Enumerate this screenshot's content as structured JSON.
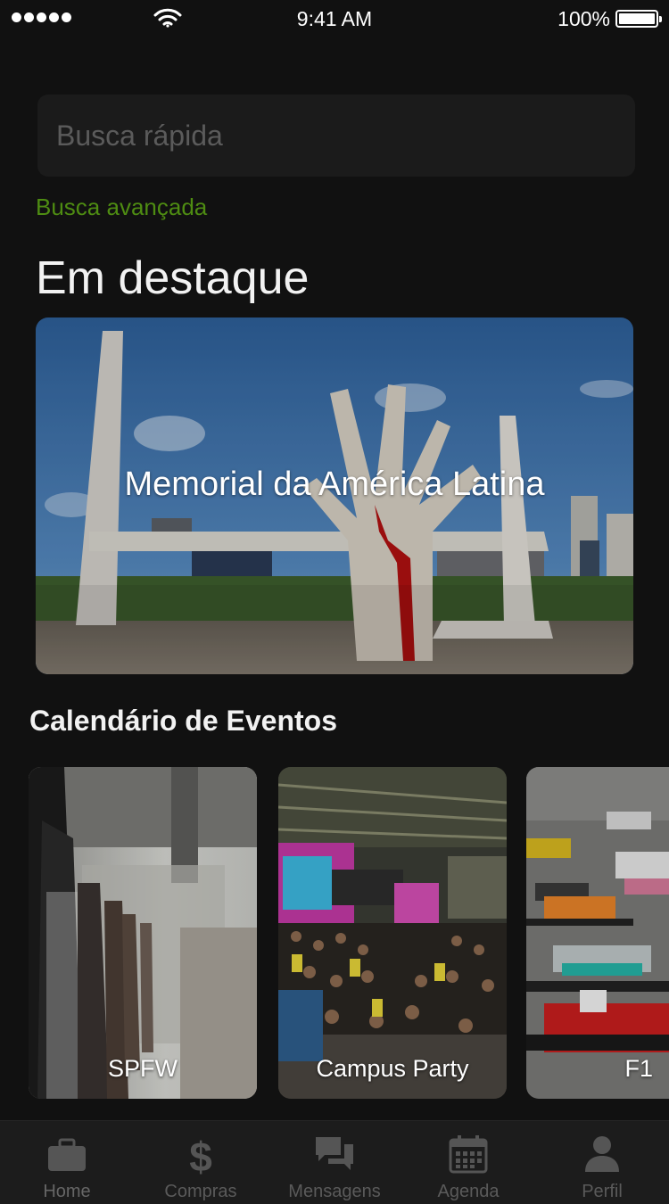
{
  "status_bar": {
    "time": "9:41 AM",
    "battery": "100%",
    "icons": [
      "signal-dots-icon",
      "wifi-icon",
      "battery-icon"
    ]
  },
  "search": {
    "placeholder": "Busca rápida",
    "advanced_link": "Busca avançada"
  },
  "featured": {
    "section_title": "Em destaque",
    "card_title": "Memorial da América Latina"
  },
  "events": {
    "section_title": "Calendário de Eventos",
    "items": [
      {
        "label": "SPFW"
      },
      {
        "label": "Campus Party"
      },
      {
        "label": "F1"
      }
    ]
  },
  "tab_bar": {
    "items": [
      {
        "label": "Home",
        "icon": "briefcase-icon"
      },
      {
        "label": "Compras",
        "icon": "dollar-icon"
      },
      {
        "label": "Mensagens",
        "icon": "chat-bubbles-icon"
      },
      {
        "label": "Agenda",
        "icon": "calendar-icon"
      },
      {
        "label": "Perfil",
        "icon": "person-icon"
      }
    ]
  },
  "colors": {
    "background": "#111111",
    "search_background": "#1b1b1b",
    "accent_link": "#4e8c12",
    "tab_bar": "#1c1c1c",
    "tab_inactive": "#5a5a5a"
  }
}
